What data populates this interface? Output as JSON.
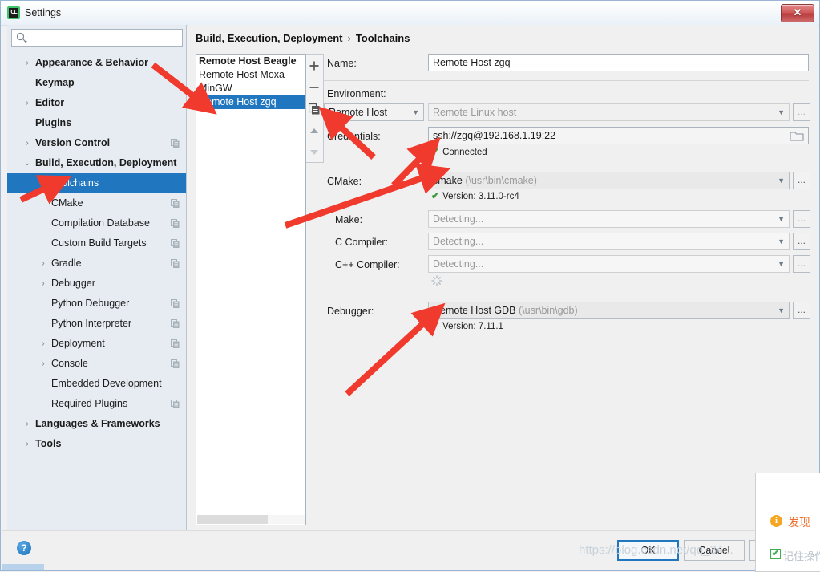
{
  "window": {
    "title": "Settings",
    "app_icon": "clion-icon",
    "close_label": "✕"
  },
  "search": {
    "value": "",
    "placeholder": "",
    "icon": "search-icon"
  },
  "sidebar": {
    "items": [
      {
        "label": "Appearance & Behavior",
        "level": 0,
        "arrow": "›",
        "bold": true,
        "selected": false,
        "copy": false
      },
      {
        "label": "Keymap",
        "level": 0,
        "arrow": "",
        "bold": true,
        "selected": false,
        "copy": false
      },
      {
        "label": "Editor",
        "level": 0,
        "arrow": "›",
        "bold": true,
        "selected": false,
        "copy": false
      },
      {
        "label": "Plugins",
        "level": 0,
        "arrow": "",
        "bold": true,
        "selected": false,
        "copy": false
      },
      {
        "label": "Version Control",
        "level": 0,
        "arrow": "›",
        "bold": true,
        "selected": false,
        "copy": true
      },
      {
        "label": "Build, Execution, Deployment",
        "level": 0,
        "arrow": "⌄",
        "bold": true,
        "selected": false,
        "copy": false
      },
      {
        "label": "Toolchains",
        "level": 1,
        "arrow": "",
        "bold": false,
        "selected": true,
        "copy": false
      },
      {
        "label": "CMake",
        "level": 1,
        "arrow": "",
        "bold": false,
        "selected": false,
        "copy": true
      },
      {
        "label": "Compilation Database",
        "level": 1,
        "arrow": "",
        "bold": false,
        "selected": false,
        "copy": true
      },
      {
        "label": "Custom Build Targets",
        "level": 1,
        "arrow": "",
        "bold": false,
        "selected": false,
        "copy": true
      },
      {
        "label": "Gradle",
        "level": 1,
        "arrow": "›",
        "bold": false,
        "selected": false,
        "copy": true
      },
      {
        "label": "Debugger",
        "level": 1,
        "arrow": "›",
        "bold": false,
        "selected": false,
        "copy": false
      },
      {
        "label": "Python Debugger",
        "level": 1,
        "arrow": "",
        "bold": false,
        "selected": false,
        "copy": true
      },
      {
        "label": "Python Interpreter",
        "level": 1,
        "arrow": "",
        "bold": false,
        "selected": false,
        "copy": true
      },
      {
        "label": "Deployment",
        "level": 1,
        "arrow": "›",
        "bold": false,
        "selected": false,
        "copy": true
      },
      {
        "label": "Console",
        "level": 1,
        "arrow": "›",
        "bold": false,
        "selected": false,
        "copy": true
      },
      {
        "label": "Embedded Development",
        "level": 1,
        "arrow": "",
        "bold": false,
        "selected": false,
        "copy": false
      },
      {
        "label": "Required Plugins",
        "level": 1,
        "arrow": "",
        "bold": false,
        "selected": false,
        "copy": true
      },
      {
        "label": "Languages & Frameworks",
        "level": 0,
        "arrow": "›",
        "bold": true,
        "selected": false,
        "copy": false
      },
      {
        "label": "Tools",
        "level": 0,
        "arrow": "›",
        "bold": true,
        "selected": false,
        "copy": false
      }
    ]
  },
  "breadcrumb": {
    "root": "Build, Execution, Deployment",
    "separator": "›",
    "leaf": "Toolchains"
  },
  "toolchain_list": {
    "items": [
      {
        "label": "Remote Host Beagle",
        "bold": true,
        "selected": false
      },
      {
        "label": "Remote Host Moxa",
        "bold": false,
        "selected": false
      },
      {
        "label": "MinGW",
        "bold": false,
        "selected": false
      },
      {
        "label": "Remote Host zgq",
        "bold": false,
        "selected": true
      }
    ],
    "toolbar": [
      {
        "name": "add-toolchain-button",
        "glyph": "+"
      },
      {
        "name": "remove-toolchain-button",
        "glyph": "−"
      },
      {
        "name": "copy-toolchain-button",
        "glyph": "copy"
      },
      {
        "name": "move-up-button",
        "glyph": "▲"
      },
      {
        "name": "move-down-button",
        "glyph": "▼"
      }
    ]
  },
  "form": {
    "name_label": "Name:",
    "name_value": "Remote Host zgq",
    "environment_label": "Environment:",
    "environment_value": "Remote Host",
    "environment_host_placeholder": "Remote Linux host",
    "environment_host_value": "",
    "credentials_label": "Credentials:",
    "credentials_value": "ssh://zgq@192.168.1.19:22",
    "credentials_status": "Connected",
    "cmake_label": "CMake:",
    "cmake_value": "cmake",
    "cmake_path": "(\\usr\\bin\\cmake)",
    "cmake_status": "Version: 3.11.0-rc4",
    "make_label": "Make:",
    "make_value": "Detecting...",
    "c_compiler_label": "C Compiler:",
    "c_compiler_value": "Detecting...",
    "cpp_compiler_label": "C++ Compiler:",
    "cpp_compiler_value": "Detecting...",
    "debugger_label": "Debugger:",
    "debugger_value": "Remote Host GDB",
    "debugger_path": "(\\usr\\bin\\gdb)",
    "debugger_status": "Version: 7.11.1",
    "ellipsis_label": "...",
    "status_tick": "✔"
  },
  "footer": {
    "help_label": "?",
    "ok_label": "OK",
    "cancel_label": "Cancel",
    "apply_label": "",
    "watermark": "https://blog.csdn.net/qq_34..."
  },
  "popup": {
    "info_icon": "info-icon",
    "info_glyph": "i",
    "title": "发现",
    "checkbox_checked": true,
    "checkbox_glyph": "✔",
    "checkbox_label": "记住操作"
  },
  "colors": {
    "selection_blue": "#2077c0",
    "sidebar_bg": "#e6ecf2",
    "arrow_red": "#ef3a2d",
    "ok_border": "#2077c0",
    "status_green": "#3a9a3a",
    "popup_orange": "#f07030"
  }
}
